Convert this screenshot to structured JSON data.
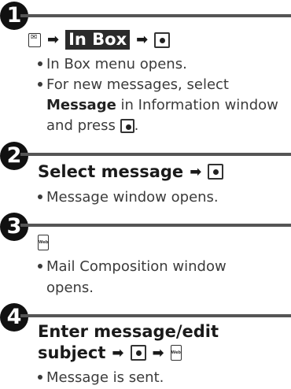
{
  "steps": [
    {
      "number": "1",
      "action": {
        "inbox_label": "In Box"
      },
      "notes": [
        "In Box menu opens.",
        "For new messages, select",
        "Message",
        " in Information window",
        "and press ",
        "."
      ]
    },
    {
      "number": "2",
      "action": {
        "text": "Select message"
      },
      "notes": [
        "Message window opens."
      ]
    },
    {
      "number": "3",
      "action": {
        "web_key_label": "Web"
      },
      "notes": [
        "Mail Composition window",
        "opens."
      ]
    },
    {
      "number": "4",
      "action": {
        "text_line1": "Enter message/edit",
        "text_line2": "subject"
      },
      "notes": [
        "Message is sent."
      ]
    }
  ],
  "icons": {
    "mail_key": "mail-key-icon",
    "center_key": "center-select-key-icon",
    "web_key": "web-key-icon",
    "arrow": "right-arrow-icon"
  }
}
